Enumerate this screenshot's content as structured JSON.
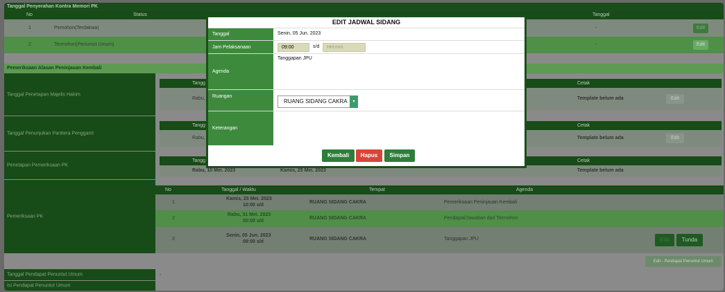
{
  "background": {
    "section1_title": "Tanggal Penyerahan Kontra Memori PK",
    "s1_headers": {
      "no": "No",
      "status": "Status",
      "tanggal": "Tanggal"
    },
    "s1_rows": [
      {
        "no": "1",
        "status": "Pemohon(Terdakwa)",
        "tanggal": "-",
        "action": "Edit"
      },
      {
        "no": "2",
        "status": "Termohon(Penuntut Umum)",
        "tanggal": "-",
        "action": "Edit"
      }
    ],
    "section2_title": "Pemeriksaan Alasan Peninjauan Kembali",
    "majelis": {
      "label": "Tanggal Penetapan Majelis Hakim",
      "header_date": "Tangg",
      "value": "Rabu,",
      "cetak_header": "Cetak",
      "cetak_value": "Template belum ada",
      "action": "Edit"
    },
    "panitera": {
      "label": "Tanggal Penunjukan Panitera Pengganti",
      "header_date": "Tangg",
      "value": "Rabu,",
      "cetak_header": "Cetak",
      "cetak_value": "Template belum ada",
      "action": "Edit"
    },
    "penetapan": {
      "label": "Penetapan Pemeriksaan PK",
      "header_date": "Tangg",
      "value1": "Rabu, 10 Mei. 2023",
      "value2": "Kamis, 25 Mei. 2023",
      "cetak_header": "Cetak",
      "cetak_value": "Template belum ada"
    },
    "pemeriksaan": {
      "label": "Pemeriksaan PK",
      "headers": {
        "no": "No",
        "tanggal": "Tanggal / Waktu",
        "tempat": "Tempat",
        "agenda": "Agenda"
      },
      "rows": [
        {
          "no": "1",
          "date": "Kamis, 25 Mei. 2023",
          "time": "10:00 s/d",
          "tempat": "RUANG SIDANG CAKRA",
          "agenda": "Pemeriksaan Peninjauan Kembali"
        },
        {
          "no": "2",
          "date": "Rabu, 31 Mei. 2023",
          "time": "00:00 s/d",
          "tempat": "RUANG SIDANG CAKRA",
          "agenda": "Pendapat/Jawaban dari Termohon"
        },
        {
          "no": "3",
          "date": "Senin, 05 Jun. 2023",
          "time": "09:00 s/d",
          "tempat": "RUANG SIDANG CAKRA",
          "agenda": "Tanggapan JPU"
        }
      ],
      "edit_label": "Edit",
      "tunda_label": "Tunda",
      "pendapat_button": "Edit - Pendapat Penuntut Umum"
    },
    "pendapat_label": "Tanggal Pendapat Penuntut Umum",
    "pendapat_value": "-",
    "isi_label": "Isi Pendapat Penuntut Umum"
  },
  "modal": {
    "title": "EDIT JADWAL SIDANG",
    "tanggal_label": "Tanggal",
    "tanggal_value": "Senin, 05 Jun. 2023",
    "jam_label": "Jam Pelaksanaan",
    "jam_start": "09:00",
    "jam_sep": "s/d",
    "jam_end_placeholder": "HH:mm",
    "agenda_label": "Agenda",
    "agenda_value": "Tanggapan JPU",
    "ruangan_label": "Ruangan",
    "ruangan_value": "RUANG SIDANG CAKRA",
    "keterangan_label": "Keterangan",
    "keterangan_value": "",
    "btn_kembali": "Kembali",
    "btn_hapus": "Hapus",
    "btn_simpan": "Simpan",
    "colors": {
      "kembali": "#2f7d3a",
      "hapus": "#d9443a",
      "simpan": "#2f7d3a",
      "label_bg": "#3d8a3d"
    }
  }
}
